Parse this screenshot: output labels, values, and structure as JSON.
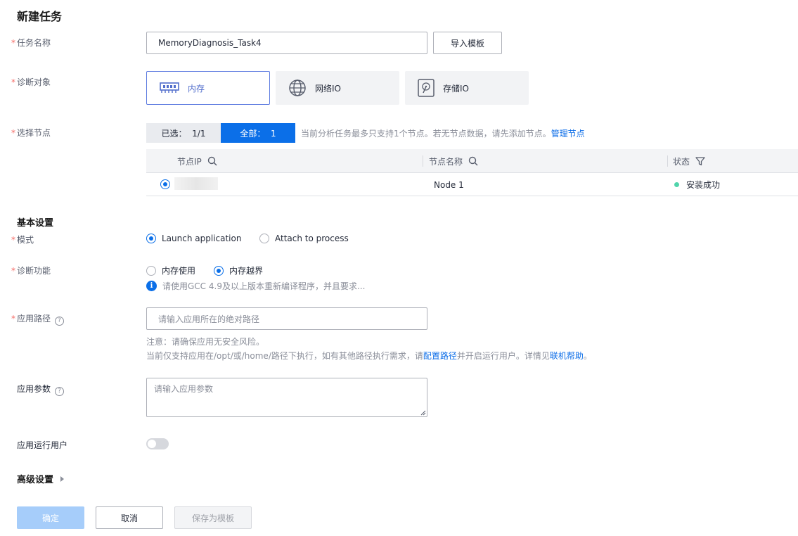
{
  "page": {
    "title": "新建任务"
  },
  "task_name": {
    "label": "任务名称",
    "value": "MemoryDiagnosis_Task4",
    "import_button": "导入模板"
  },
  "diag_target": {
    "label": "诊断对象",
    "options": [
      {
        "label": "内存",
        "icon": "memory-icon",
        "selected": true
      },
      {
        "label": "网络IO",
        "icon": "globe-icon",
        "selected": false
      },
      {
        "label": "存储IO",
        "icon": "disk-icon",
        "selected": false
      }
    ]
  },
  "node_select": {
    "label": "选择节点",
    "selected_tab": "已选：  1/1",
    "all_tab": "全部：  1",
    "hint": "当前分析任务最多只支持1个节点。若无节点数据，请先添加节点。",
    "manage_link": "管理节点",
    "columns": {
      "ip": "节点IP",
      "name": "节点名称",
      "status": "状态"
    },
    "rows": [
      {
        "ip": "",
        "name": "Node 1",
        "status": "安装成功",
        "selected": true
      }
    ]
  },
  "basic": {
    "title": "基本设置",
    "mode": {
      "label": "模式",
      "options": [
        "Launch application",
        "Attach to process"
      ],
      "selected": 0
    },
    "function": {
      "label": "诊断功能",
      "options": [
        "内存使用",
        "内存越界"
      ],
      "selected": 1,
      "info": "请使用GCC 4.9及以上版本重新编译程序，并且要求..."
    },
    "app_path": {
      "label": "应用路径",
      "placeholder": "请输入应用所在的绝对路径",
      "note1": "注意：请确保应用无安全风险。",
      "note2_a": "当前仅支持应用在/opt/或/home/路径下执行，如有其他路径执行需求，请",
      "note2_link1": "配置路径",
      "note2_b": "并开启运行用户。详情见",
      "note2_link2": "联机帮助",
      "note2_c": "。"
    },
    "app_params": {
      "label": "应用参数",
      "placeholder": "请输入应用参数"
    },
    "run_user": {
      "label": "应用运行用户",
      "enabled": false
    }
  },
  "advanced": {
    "title": "高级设置"
  },
  "footer": {
    "confirm": "确定",
    "cancel": "取消",
    "save_template": "保存为模板"
  },
  "colors": {
    "primary": "#0b6fe8",
    "success": "#50d4ab",
    "required": "#f66f6a"
  }
}
